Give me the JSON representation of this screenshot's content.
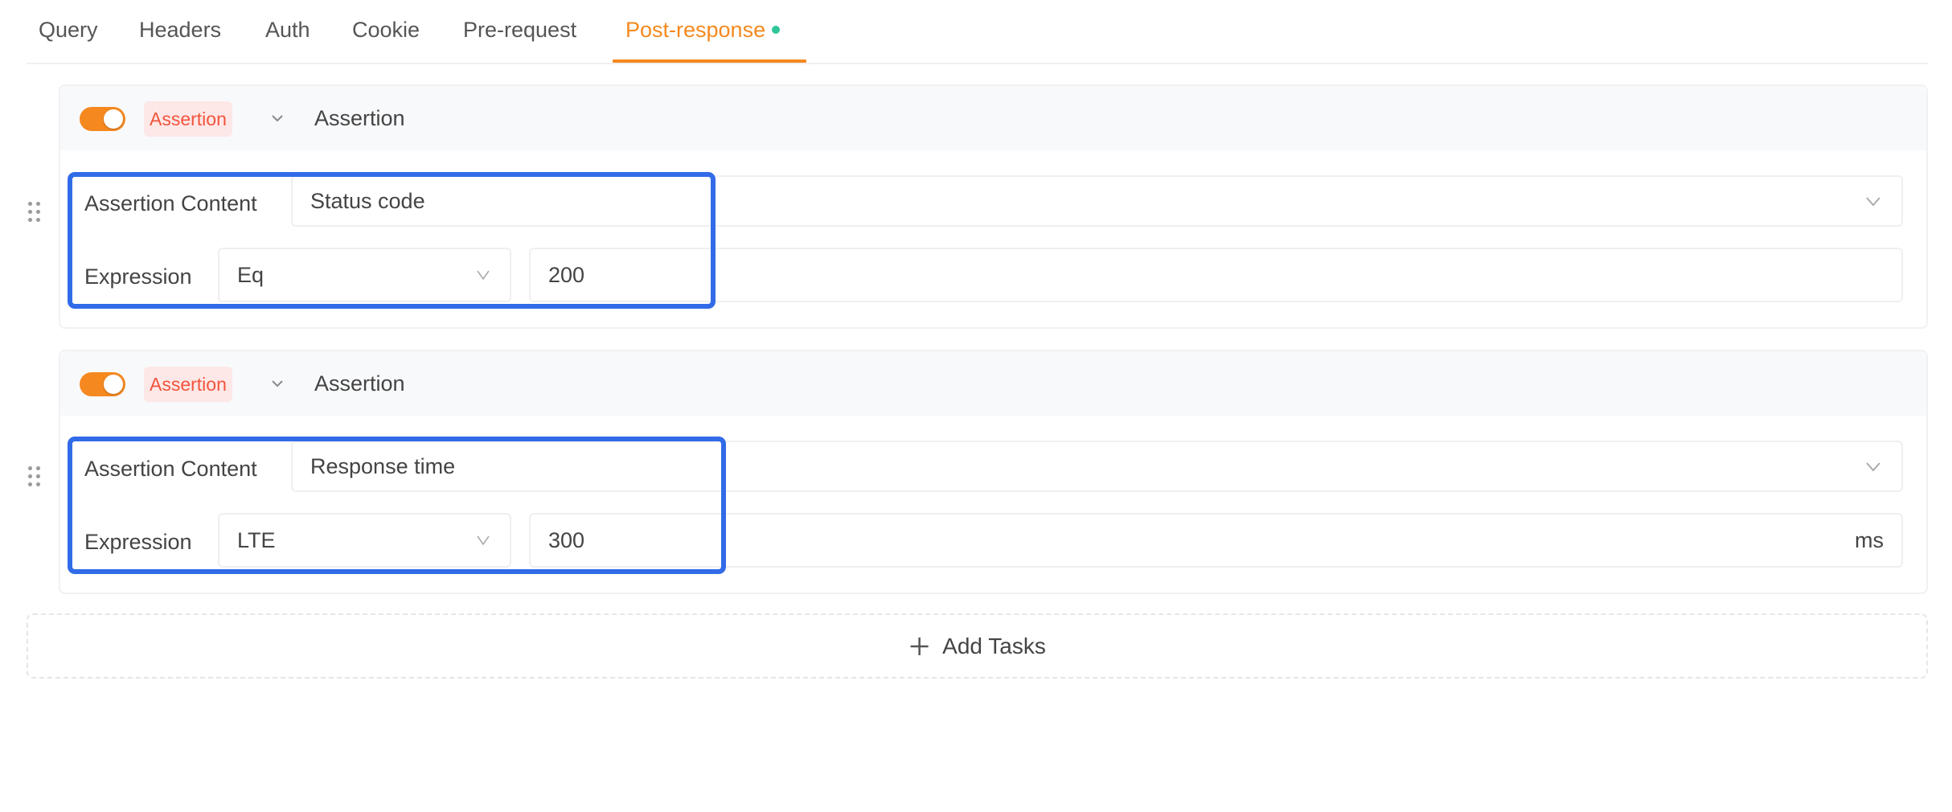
{
  "tabs": [
    {
      "label": "Query",
      "active": false
    },
    {
      "label": "Headers",
      "active": false
    },
    {
      "label": "Auth",
      "active": false
    },
    {
      "label": "Cookie",
      "active": false
    },
    {
      "label": "Pre-request",
      "active": false
    },
    {
      "label": "Post-response",
      "active": true,
      "has_indicator": true
    }
  ],
  "colors": {
    "accent": "#f5891f",
    "indicator": "#2ec59a",
    "badge_text": "#f2543d",
    "badge_bg": "#fde8e7",
    "highlight": "#316be8"
  },
  "assertions": [
    {
      "enabled": true,
      "badge": "Assertion",
      "title": "Assertion",
      "content_label": "Assertion Content",
      "content_value": "Status code",
      "expression_label": "Expression",
      "operator": "Eq",
      "value": "200",
      "suffix": ""
    },
    {
      "enabled": true,
      "badge": "Assertion",
      "title": "Assertion",
      "content_label": "Assertion Content",
      "content_value": "Response time",
      "expression_label": "Expression",
      "operator": "LTE",
      "value": "300",
      "suffix": "ms"
    }
  ],
  "add_tasks": {
    "label": "Add Tasks",
    "icon": "plus-icon"
  }
}
